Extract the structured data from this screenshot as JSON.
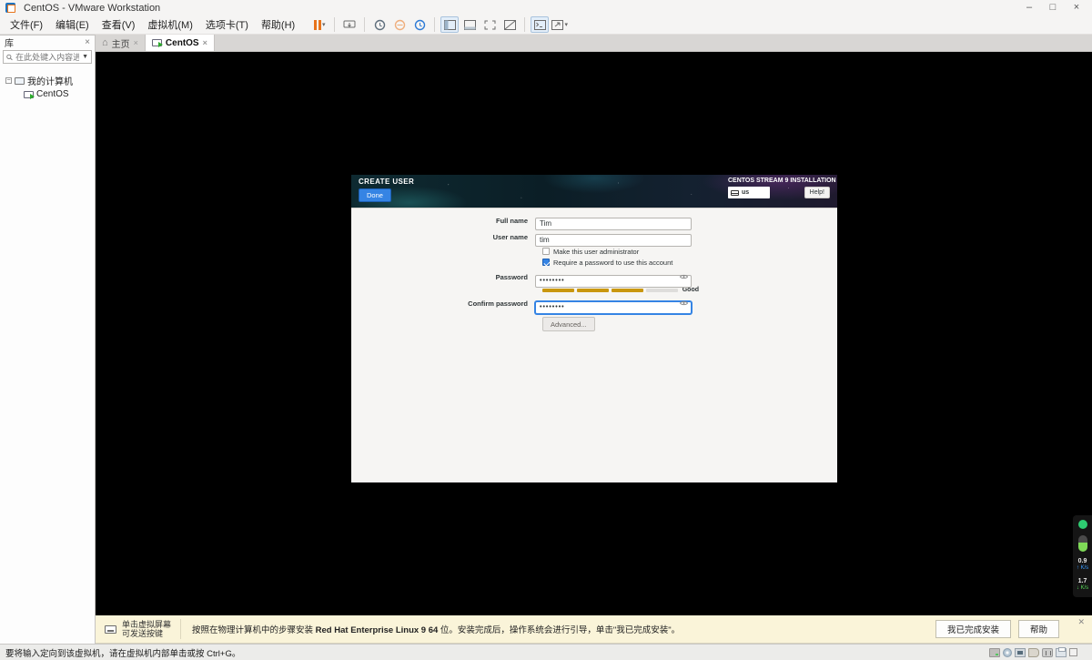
{
  "window": {
    "title": "CentOS - VMware Workstation",
    "minimize": "–",
    "maximize": "□",
    "close": "×"
  },
  "menubar": {
    "items": [
      "文件(F)",
      "编辑(E)",
      "查看(V)",
      "虚拟机(M)",
      "选项卡(T)",
      "帮助(H)"
    ]
  },
  "toolbar": {
    "icons": [
      "suspend-pause-icon",
      "ctrl-alt-del-icon",
      "take-snapshot-icon",
      "revert-snapshot-icon",
      "snapshot-manager-icon",
      "show-library-icon",
      "show-thumbnail-bar-icon",
      "fullscreen-icon",
      "unity-mode-icon",
      "console-view-icon",
      "expand-display-icon"
    ]
  },
  "tabs": [
    {
      "label": "主页"
    },
    {
      "label": "CentOS"
    }
  ],
  "sidebar": {
    "header": "库",
    "search_placeholder": "在此处键入内容进...",
    "tree": [
      {
        "label": "我的计算机"
      },
      {
        "label": "CentOS"
      }
    ]
  },
  "installer": {
    "screen_title": "CREATE USER",
    "done_label": "Done",
    "distro_title": "CENTOS STREAM 9 INSTALLATION",
    "keyboard_layout": "us",
    "help_label": "Help!",
    "form": {
      "full_name_label": "Full name",
      "full_name_value": "Tim",
      "user_name_label": "User name",
      "user_name_value": "tim",
      "admin_checkbox_label": "Make this user administrator",
      "admin_checkbox_checked": false,
      "require_password_label": "Require a password to use this account",
      "require_password_checked": true,
      "password_label": "Password",
      "password_value": "••••••••",
      "strength_label": "Good",
      "confirm_label": "Confirm password",
      "confirm_value": "••••••••",
      "advanced_label": "Advanced..."
    }
  },
  "hint_bar": {
    "tip_line1": "单击虚拟屏幕",
    "tip_line2": "可发送按键",
    "message_pre": "按照在物理计算机中的步骤安装 ",
    "message_bold": "Red Hat Enterprise Linux 9 64",
    "message_post": " 位。安装完成后，操作系统会进行引导，单击\"我已完成安装\"。",
    "finish_button": "我已完成安装",
    "help_button": "帮助"
  },
  "status_bar": {
    "message": "要将输入定向到该虚拟机，请在虚拟机内部单击或按 Ctrl+G。"
  },
  "net_widget": {
    "up_value": "0.9",
    "up_unit": "↑ K/s",
    "down_value": "1.7",
    "down_unit": "↓ K/s"
  },
  "colors": {
    "accent": "#3584e4",
    "strength_fill": "#c9970f",
    "pause_orange": "#e8731a",
    "hint_bg": "#faf4d9",
    "header_bg": "#0e2a31"
  }
}
